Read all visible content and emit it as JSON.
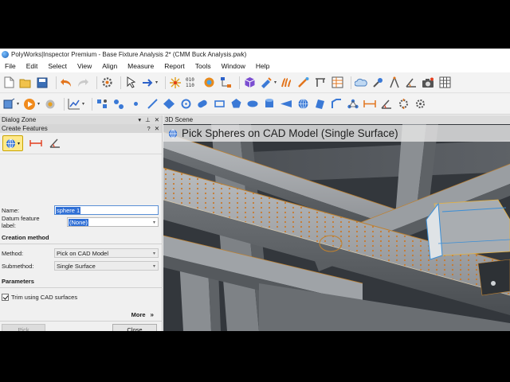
{
  "window": {
    "title": "PolyWorks|Inspector Premium - Base Fixture Analysis 2* (CMM Buck Analysis.pwk)"
  },
  "menu": [
    "File",
    "Edit",
    "Select",
    "View",
    "Align",
    "Measure",
    "Report",
    "Tools",
    "Window",
    "Help"
  ],
  "dialog_zone": {
    "title": "Dialog Zone",
    "panel_title": "Create Features",
    "name_label": "Name:",
    "name_value": "sphere 1",
    "datum_label": "Datum feature label:",
    "datum_value": "(None)",
    "creation_method_title": "Creation method",
    "method_label": "Method:",
    "method_value": "Pick on CAD Model",
    "submethod_label": "Submethod:",
    "submethod_value": "Single Surface",
    "parameters_title": "Parameters",
    "trim_label": "Trim using CAD surfaces",
    "more_label": "More",
    "pick_button": "Pick",
    "close_button": "Close"
  },
  "scene": {
    "title": "3D Scene",
    "banner": "Pick Spheres on CAD Model (Single Surface)"
  },
  "colors": {
    "accent_pick": "#ffe98a",
    "highlight": "#2f6fd6",
    "cad_steel": "#9a9da1",
    "cad_edge": "#c0812e",
    "scene_bg": "#34383d"
  }
}
